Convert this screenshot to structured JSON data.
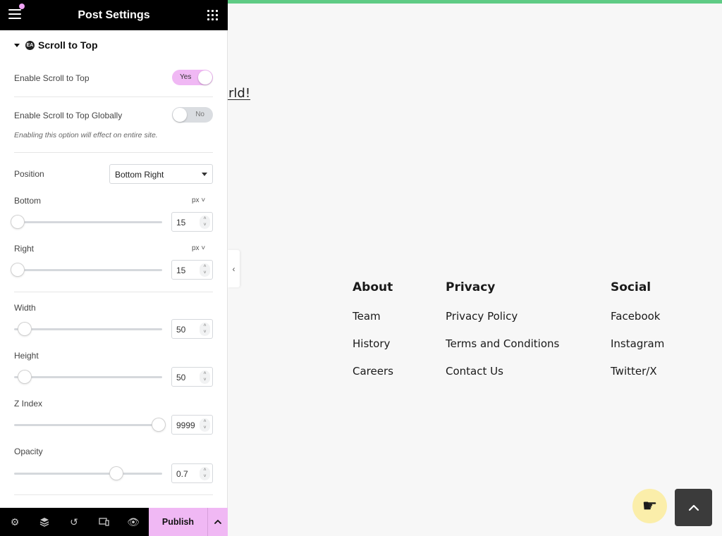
{
  "panel": {
    "title": "Post Settings",
    "section": {
      "title": "Scroll to Top",
      "logo_text": "EA"
    },
    "enable_scroll": {
      "label": "Enable Scroll to Top",
      "toggle": "Yes",
      "state": "on"
    },
    "enable_global": {
      "label": "Enable Scroll to Top Globally",
      "toggle": "No",
      "state": "off",
      "note": "Enabling this option will effect on entire site."
    },
    "position": {
      "label": "Position",
      "value": "Bottom Right"
    },
    "bottom": {
      "label": "Bottom",
      "unit": "px ˅",
      "value": "15",
      "level": 0.0
    },
    "right": {
      "label": "Right",
      "unit": "px ˅",
      "value": "15",
      "level": 0.0
    },
    "width": {
      "label": "Width",
      "value": "50",
      "level": 0.05
    },
    "height": {
      "label": "Height",
      "value": "50",
      "level": 0.05
    },
    "z_index": {
      "label": "Z Index",
      "value": "9999",
      "level": 1.0
    },
    "opacity": {
      "label": "Opacity",
      "value": "0.7",
      "level": 0.7
    }
  },
  "bottom_bar": {
    "icons": [
      "settings-icon",
      "layers-icon",
      "history-icon",
      "responsive-icon",
      "preview-eye-icon"
    ],
    "publish_label": "Publish"
  },
  "preview": {
    "hello_text": "orld!",
    "footer": {
      "about": {
        "heading": "About",
        "links": [
          "Team",
          "History",
          "Careers"
        ]
      },
      "privacy": {
        "heading": "Privacy",
        "links": [
          "Privacy Policy",
          "Terms and Conditions",
          "Contact Us"
        ]
      },
      "social": {
        "heading": "Social",
        "links": [
          "Facebook",
          "Instagram",
          "Twitter/X"
        ]
      }
    }
  },
  "colors": {
    "accent_pink": "#f0b8f4",
    "top_accent_green": "#5fcb85",
    "scroll_button_bg": "#3b3b3b"
  }
}
